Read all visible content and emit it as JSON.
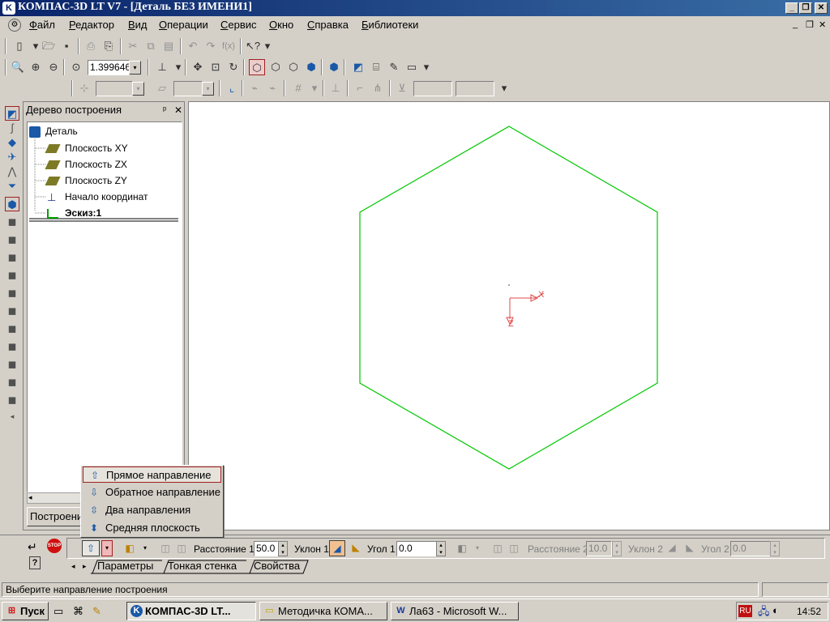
{
  "window": {
    "title": "КОМПАС-3D LT V7 - [Деталь БЕЗ ИМЕНИ1]",
    "min": "_",
    "max": "❐",
    "close": "✕"
  },
  "menu": [
    "Файл",
    "Редактор",
    "Вид",
    "Операции",
    "Сервис",
    "Окно",
    "Справка",
    "Библиотеки"
  ],
  "toolbar": {
    "zoom_value": "1.399646",
    "dropdown_arrow": "▾"
  },
  "tree_panel": {
    "title": "Дерево построения",
    "pin": "ᵖ",
    "close": "✕",
    "root": "Деталь",
    "items": [
      "Плоскость XY",
      "Плоскость ZX",
      "Плоскость ZY",
      "Начало координат",
      "Эскиз:1"
    ],
    "tab": "Построение"
  },
  "canvas": {
    "sketch_color": "#00c800",
    "axis_color": "#e04848",
    "axis_x": "X",
    "axis_z": "Z"
  },
  "popup": {
    "items": [
      "Прямое направление",
      "Обратное направление",
      "Два направления",
      "Средняя плоскость"
    ]
  },
  "properties": {
    "distance1_label": "Расстояние 1",
    "distance1_value": "50.0",
    "slope1_label": "Уклон 1",
    "angle1_label": "Угол 1",
    "angle1_value": "0.0",
    "distance2_label": "Расстояние 2",
    "distance2_value": "10.0",
    "slope2_label": "Уклон 2",
    "angle2_label": "Угол 2",
    "angle2_value": "0.0",
    "tabs": [
      "Параметры",
      "Тонкая стенка",
      "Свойства"
    ],
    "stop": "STOP",
    "help": "?"
  },
  "status": "Выберите направление построения",
  "taskbar": {
    "start": "Пуск",
    "items": [
      "КОМПАС-3D LT...",
      "Методичка КОМА...",
      "Ла63 - Microsoft W..."
    ],
    "lang": "RU",
    "time": "14:52"
  }
}
